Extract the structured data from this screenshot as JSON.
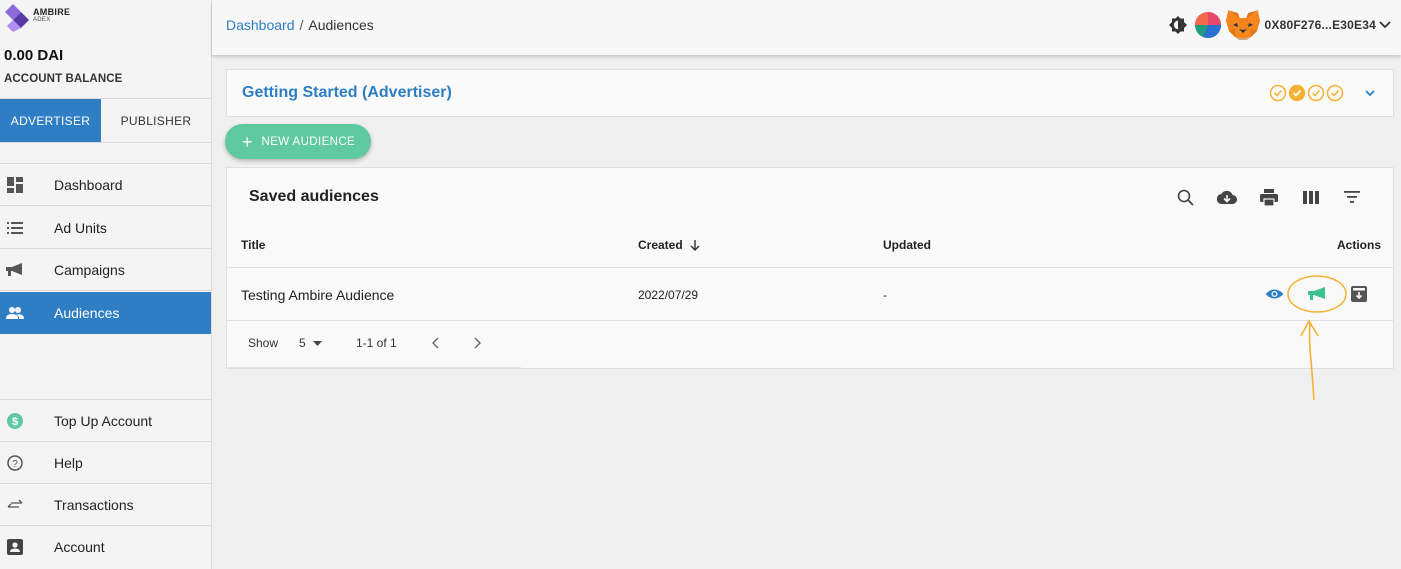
{
  "brand": {
    "name": "AMBIRE",
    "sub": "ADEX"
  },
  "account": {
    "balance": "0.00 DAI",
    "balance_label": "ACCOUNT BALANCE",
    "address": "0X80F276...E30E34"
  },
  "side_tabs": [
    {
      "label": "ADVERTISER",
      "active": true
    },
    {
      "label": "PUBLISHER",
      "active": false
    }
  ],
  "nav": [
    {
      "label": "Dashboard",
      "icon": "dashboard-icon"
    },
    {
      "label": "Ad Units",
      "icon": "list-icon"
    },
    {
      "label": "Campaigns",
      "icon": "campaign-icon"
    },
    {
      "label": "Audiences",
      "icon": "people-icon",
      "active": true
    }
  ],
  "nav_bottom": [
    {
      "label": "Top Up Account",
      "icon": "dollar-icon"
    },
    {
      "label": "Help",
      "icon": "help-icon"
    },
    {
      "label": "Transactions",
      "icon": "swap-icon"
    },
    {
      "label": "Account",
      "icon": "account-icon"
    }
  ],
  "breadcrumb": {
    "root": "Dashboard",
    "separator": "/",
    "current": "Audiences"
  },
  "getting_started": {
    "title": "Getting Started (Advertiser)",
    "steps_completed": 1,
    "steps_total": 4
  },
  "new_audience_button": {
    "plus": "+",
    "label": "NEW AUDIENCE"
  },
  "table": {
    "title": "Saved audiences",
    "toolbar_icons": [
      "search-icon",
      "cloud-download-icon",
      "print-icon",
      "columns-icon",
      "filter-icon"
    ],
    "columns": {
      "title": "Title",
      "created": "Created",
      "updated": "Updated",
      "actions": "Actions"
    },
    "rows": [
      {
        "title": "Testing Ambire Audience",
        "created": "2022/07/29",
        "updated": "-"
      }
    ],
    "pagination": {
      "show_label": "Show",
      "rows_per_page": "5",
      "range": "1-1 of 1"
    }
  },
  "colors": {
    "primary": "#2f7ec4",
    "accent_green": "#5fc9a2",
    "warning_orange": "#f5b133"
  }
}
